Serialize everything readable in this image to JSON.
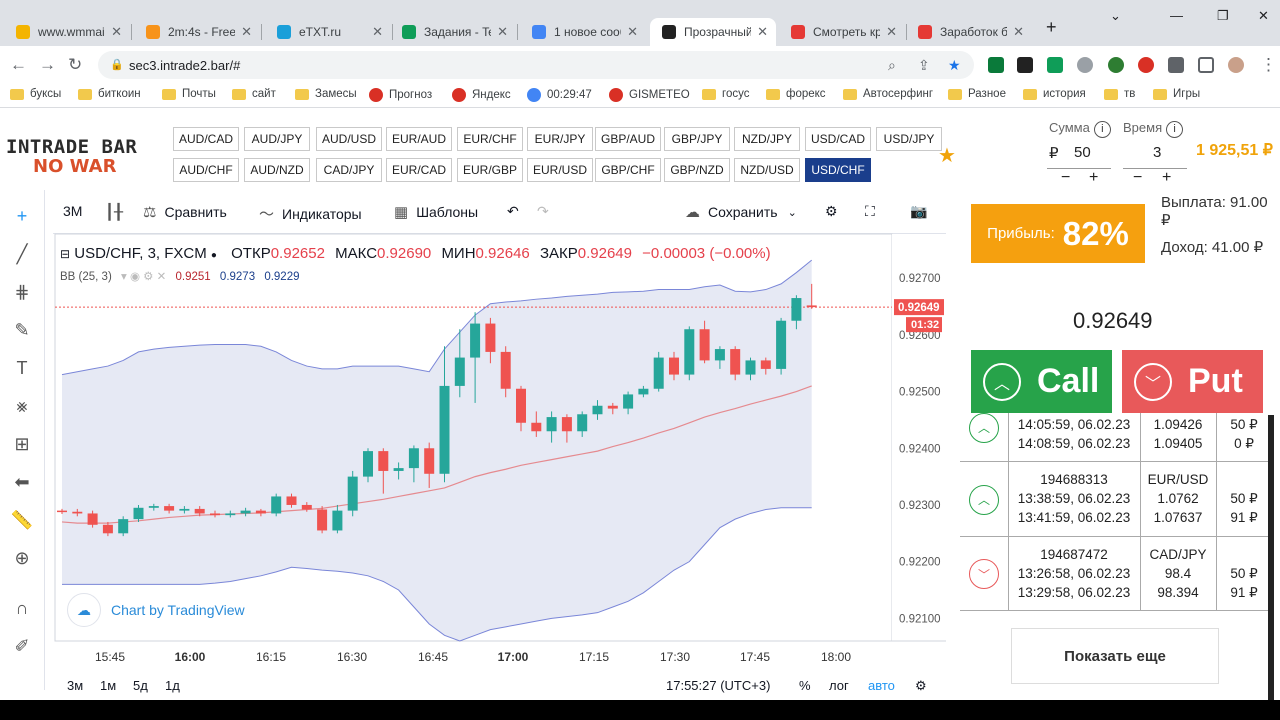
{
  "browser": {
    "tabs": [
      {
        "title": "www.wmmail",
        "color": "#f4b400"
      },
      {
        "title": "2m:4s - FreeB",
        "color": "#f7931a"
      },
      {
        "title": "eTXT.ru",
        "color": "#1a9fd9"
      },
      {
        "title": "Задания - Te",
        "color": "#0f9d58"
      },
      {
        "title": "1 новое сооб",
        "color": "#4285f4"
      },
      {
        "title": "Прозрачный",
        "color": "#222222"
      },
      {
        "title": "Смотреть кр",
        "color": "#e53935"
      },
      {
        "title": "Заработок б",
        "color": "#e53935"
      }
    ],
    "url": "sec3.intrade2.bar/#",
    "bookmarks": [
      {
        "label": "буксы",
        "type": "folder"
      },
      {
        "label": "биткоин",
        "type": "folder"
      },
      {
        "label": "Почты",
        "type": "folder"
      },
      {
        "label": "сайт",
        "type": "folder"
      },
      {
        "label": "Замесы",
        "type": "folder"
      },
      {
        "label": "Прогноз",
        "type": "icon",
        "color": "#d93025"
      },
      {
        "label": "Яндекс",
        "type": "icon",
        "color": "#d93025"
      },
      {
        "label": "00:29:47",
        "type": "icon",
        "color": "#4285f4"
      },
      {
        "label": "GISMETEO",
        "type": "icon",
        "color": "#d93025"
      },
      {
        "label": "госус",
        "type": "folder"
      },
      {
        "label": "форекс",
        "type": "folder"
      },
      {
        "label": "Автосерфинг",
        "type": "folder"
      },
      {
        "label": "Разное",
        "type": "folder"
      },
      {
        "label": "история",
        "type": "folder"
      },
      {
        "label": "тв",
        "type": "folder"
      },
      {
        "label": "Игры",
        "type": "folder"
      }
    ]
  },
  "logo": {
    "line1": "INTRADE BAR",
    "line2": "NO WAR"
  },
  "pairs_row1": [
    "AUD/CAD",
    "AUD/JPY",
    "AUD/USD",
    "EUR/AUD",
    "EUR/CHF",
    "EUR/JPY",
    "GBP/AUD",
    "GBP/JPY",
    "NZD/JPY",
    "USD/CAD",
    "USD/JPY"
  ],
  "pairs_row2": [
    "AUD/CHF",
    "AUD/NZD",
    "CAD/JPY",
    "EUR/CAD",
    "EUR/GBP",
    "EUR/USD",
    "GBP/CHF",
    "GBP/NZD",
    "NZD/USD",
    "USD/CHF"
  ],
  "selected_pair": "USD/CHF",
  "trade": {
    "sum_label": "Сумма",
    "sum_currency": "₽",
    "sum_value": "50",
    "time_label": "Время",
    "time_value": "3",
    "balance": "1 925,51 ₽",
    "profit_label": "Прибыль:",
    "profit_value": "82%",
    "payout": "Выплата: 91.00 ₽",
    "income": "Доход: 41.00 ₽",
    "price": "0.92649",
    "call_label": "Call",
    "put_label": "Put"
  },
  "chart_toolbar": {
    "interval": "3М",
    "compare": "Сравнить",
    "indicators": "Индикаторы",
    "templates": "Шаблоны",
    "save": "Сохранить"
  },
  "legend": {
    "symbol": "USD/CHF, 3, FXCM",
    "open_label": "ОТКР",
    "open": "0.92652",
    "high_label": "МАКС",
    "high": "0.92690",
    "low_label": "МИН",
    "low": "0.92646",
    "close_label": "ЗАКР",
    "close": "0.92649",
    "change": "−0.00003 (−0.00%)",
    "bb_label": "BB (25, 3)",
    "bb_mid": "0.9251",
    "bb_upper": "0.9273",
    "bb_lower": "0.9229"
  },
  "tv_brand": "Chart by TradingView",
  "bottom_bar": {
    "ranges": [
      "3м",
      "1м",
      "5д",
      "1д"
    ],
    "clock": "17:55:27 (UTC+3)",
    "percent": "%",
    "log": "лог",
    "auto": "авто"
  },
  "chart_data": {
    "type": "candlestick",
    "symbol": "USD/CHF",
    "x_ticks": [
      "15:45",
      "16:00",
      "16:15",
      "16:30",
      "16:45",
      "17:00",
      "17:15",
      "17:30",
      "17:45",
      "18:00"
    ],
    "y_ticks": [
      0.927,
      0.926,
      0.925,
      0.924,
      0.923,
      0.922,
      0.921
    ],
    "ylim": [
      0.9206,
      0.9278
    ],
    "last_price": "0.92649",
    "countdown": "01:32",
    "candles": [
      [
        0.9229,
        0.92288,
        0.92293,
        0.92284
      ],
      [
        0.92288,
        0.92285,
        0.92293,
        0.9228
      ],
      [
        0.92285,
        0.92265,
        0.9229,
        0.9226
      ],
      [
        0.92265,
        0.9225,
        0.9227,
        0.92245
      ],
      [
        0.9225,
        0.92275,
        0.9228,
        0.92245
      ],
      [
        0.92275,
        0.92295,
        0.923,
        0.9227
      ],
      [
        0.92295,
        0.92298,
        0.92302,
        0.9229
      ],
      [
        0.92298,
        0.9229,
        0.92302,
        0.92285
      ],
      [
        0.9229,
        0.92293,
        0.92298,
        0.92285
      ],
      [
        0.92293,
        0.92285,
        0.92298,
        0.9228
      ],
      [
        0.92285,
        0.92282,
        0.9229,
        0.92278
      ],
      [
        0.92282,
        0.92285,
        0.9229,
        0.92278
      ],
      [
        0.92285,
        0.9229,
        0.92295,
        0.9228
      ],
      [
        0.9229,
        0.92285,
        0.92293,
        0.9228
      ],
      [
        0.92285,
        0.92315,
        0.9232,
        0.9228
      ],
      [
        0.92315,
        0.923,
        0.9232,
        0.92295
      ],
      [
        0.923,
        0.92292,
        0.92305,
        0.92288
      ],
      [
        0.92292,
        0.92255,
        0.92298,
        0.9225
      ],
      [
        0.92255,
        0.9229,
        0.923,
        0.9225
      ],
      [
        0.9229,
        0.9235,
        0.9236,
        0.9228
      ],
      [
        0.9235,
        0.92395,
        0.924,
        0.9234
      ],
      [
        0.92395,
        0.9236,
        0.924,
        0.9232
      ],
      [
        0.9236,
        0.92365,
        0.92375,
        0.92345
      ],
      [
        0.92365,
        0.924,
        0.92405,
        0.9234
      ],
      [
        0.924,
        0.92355,
        0.9241,
        0.9233
      ],
      [
        0.92355,
        0.9251,
        0.9258,
        0.9234
      ],
      [
        0.9251,
        0.9256,
        0.9261,
        0.9249
      ],
      [
        0.9256,
        0.9262,
        0.9264,
        0.9248
      ],
      [
        0.9262,
        0.9257,
        0.9263,
        0.9255
      ],
      [
        0.9257,
        0.92505,
        0.9258,
        0.9249
      ],
      [
        0.92505,
        0.92445,
        0.9251,
        0.9243
      ],
      [
        0.92445,
        0.9243,
        0.92465,
        0.9242
      ],
      [
        0.9243,
        0.92455,
        0.92465,
        0.9241
      ],
      [
        0.92455,
        0.9243,
        0.9246,
        0.9241
      ],
      [
        0.9243,
        0.9246,
        0.92465,
        0.9242
      ],
      [
        0.9246,
        0.92475,
        0.92485,
        0.9245
      ],
      [
        0.92475,
        0.9247,
        0.9248,
        0.9246
      ],
      [
        0.9247,
        0.92495,
        0.925,
        0.9246
      ],
      [
        0.92495,
        0.92505,
        0.9251,
        0.9249
      ],
      [
        0.92505,
        0.9256,
        0.9257,
        0.925
      ],
      [
        0.9256,
        0.9253,
        0.9257,
        0.9252
      ],
      [
        0.9253,
        0.9261,
        0.92615,
        0.9252
      ],
      [
        0.9261,
        0.92555,
        0.92625,
        0.9255
      ],
      [
        0.92555,
        0.92575,
        0.9258,
        0.9254
      ],
      [
        0.92575,
        0.9253,
        0.9258,
        0.9252
      ],
      [
        0.9253,
        0.92555,
        0.9256,
        0.9252
      ],
      [
        0.92555,
        0.9254,
        0.9256,
        0.9253
      ],
      [
        0.9254,
        0.92625,
        0.9263,
        0.9253
      ],
      [
        0.92625,
        0.92665,
        0.9267,
        0.9261
      ],
      [
        0.92652,
        0.92649,
        0.9269,
        0.92646
      ]
    ],
    "bb_upper": [
      0.9253,
      0.92535,
      0.9254,
      0.92545,
      0.92555,
      0.9257,
      0.92575,
      0.92578,
      0.9258,
      0.92582,
      0.92583,
      0.92583,
      0.92583,
      0.9258,
      0.9257,
      0.92555,
      0.92545,
      0.9254,
      0.9254,
      0.92545,
      0.92545,
      0.92545,
      0.92545,
      0.9254,
      0.92535,
      0.92575,
      0.92605,
      0.92635,
      0.92655,
      0.92658,
      0.9266,
      0.92663,
      0.92665,
      0.92668,
      0.9267,
      0.92672,
      0.92675,
      0.92676,
      0.92677,
      0.9268,
      0.9268,
      0.9268,
      0.92685,
      0.92688,
      0.92677,
      0.92676,
      0.9268,
      0.9269,
      0.9271,
      0.92732
    ],
    "bb_middle": [
      0.9227,
      0.92268,
      0.92268,
      0.92268,
      0.9227,
      0.92272,
      0.92275,
      0.92278,
      0.9228,
      0.92282,
      0.92283,
      0.92284,
      0.92285,
      0.92286,
      0.92288,
      0.9229,
      0.92292,
      0.92294,
      0.92298,
      0.92302,
      0.92306,
      0.9231,
      0.92315,
      0.9232,
      0.92325,
      0.9233,
      0.9234,
      0.9235,
      0.92357,
      0.92363,
      0.9237,
      0.92375,
      0.9238,
      0.92385,
      0.9239,
      0.92395,
      0.92403,
      0.9241,
      0.92418,
      0.92427,
      0.92435,
      0.92445,
      0.92455,
      0.92463,
      0.9247,
      0.92478,
      0.92485,
      0.92492,
      0.925,
      0.9251
    ],
    "bb_lower": [
      0.9216,
      0.9216,
      0.9216,
      0.9216,
      0.9216,
      0.9216,
      0.9216,
      0.9216,
      0.9216,
      0.9216,
      0.92162,
      0.92165,
      0.9217,
      0.92175,
      0.92182,
      0.9219,
      0.92188,
      0.92185,
      0.92183,
      0.9218,
      0.92175,
      0.92165,
      0.9215,
      0.9212,
      0.9209,
      0.9207,
      0.9206,
      0.9207,
      0.9208,
      0.92085,
      0.9209,
      0.92095,
      0.921,
      0.92103,
      0.92106,
      0.9211,
      0.9212,
      0.9213,
      0.92145,
      0.92165,
      0.92185,
      0.922,
      0.9223,
      0.9226,
      0.92275,
      0.92285,
      0.92292,
      0.92295,
      0.92295,
      0.92295
    ],
    "colors": {
      "up": "#26a69a",
      "down": "#ef5350",
      "bb_band": "#b4bde0",
      "bb_mid": "#e5404b"
    }
  },
  "deals_partial": {
    "open_time": "14:05:59, 06.02.23",
    "close_time": "14:08:59, 06.02.23",
    "open_price": "1.09426",
    "close_price": "1.09405",
    "amount": "50 ₽",
    "payout": "0 ₽",
    "direction": "up"
  },
  "deals": [
    {
      "id": "194688313",
      "open_time": "13:38:59, 06.02.23",
      "close_time": "13:41:59, 06.02.23",
      "pair": "EUR/USD",
      "open_price": "1.0762",
      "close_price": "1.07637",
      "amount": "50 ₽",
      "payout": "91 ₽",
      "direction": "up"
    },
    {
      "id": "194687472",
      "open_time": "13:26:58, 06.02.23",
      "close_time": "13:29:58, 06.02.23",
      "pair": "CAD/JPY",
      "open_price": "98.4",
      "close_price": "98.394",
      "amount": "50 ₽",
      "payout": "91 ₽",
      "direction": "down"
    }
  ],
  "show_more": "Показать еще",
  "colors": {
    "call": "#27a34a",
    "put": "#e8595a",
    "profit": "#f5a00f",
    "selected_pair": "#1a3e8c",
    "balance": "#f0a30a"
  }
}
